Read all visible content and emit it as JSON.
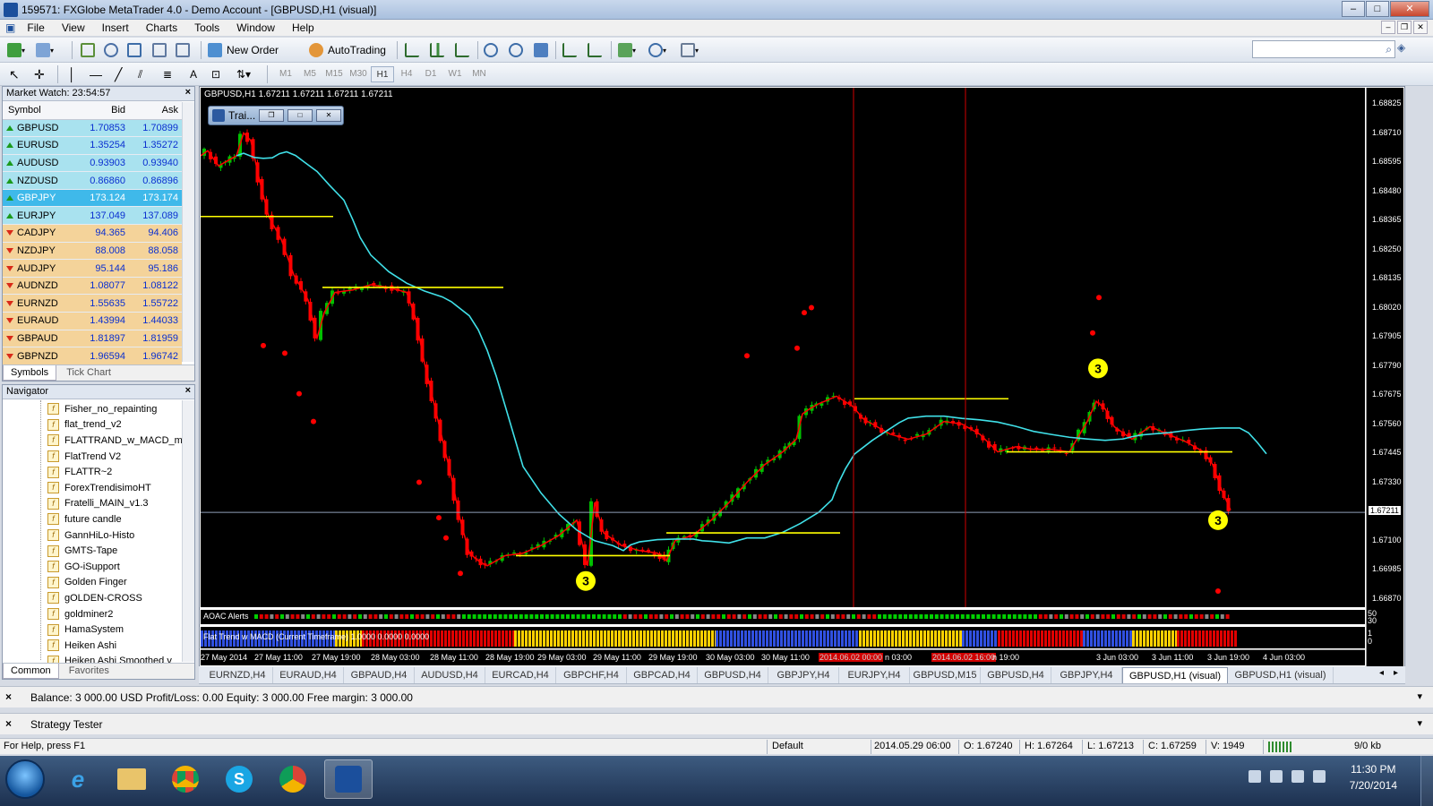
{
  "window": {
    "title": "159571: FXGlobe MetaTrader 4.0 - Demo Account - [GBPUSD,H1 (visual)]",
    "controls": [
      "–",
      "□",
      "✕"
    ]
  },
  "menu": [
    "File",
    "View",
    "Insert",
    "Charts",
    "Tools",
    "Window",
    "Help"
  ],
  "toolbar": {
    "new_order": "New Order",
    "autotrading": "AutoTrading",
    "timeframes": [
      "M1",
      "M5",
      "M15",
      "M30",
      "H1",
      "H4",
      "D1",
      "W1",
      "MN"
    ],
    "active_timeframe": "H1",
    "drawing_label": "A"
  },
  "market_watch": {
    "title": "Market Watch: 23:54:57",
    "columns": [
      "Symbol",
      "Bid",
      "Ask"
    ],
    "rows": [
      {
        "symbol": "GBPUSD",
        "bid": "1.70853",
        "ask": "1.70899",
        "dir": "up"
      },
      {
        "symbol": "EURUSD",
        "bid": "1.35254",
        "ask": "1.35272",
        "dir": "up"
      },
      {
        "symbol": "AUDUSD",
        "bid": "0.93903",
        "ask": "0.93940",
        "dir": "up"
      },
      {
        "symbol": "NZDUSD",
        "bid": "0.86860",
        "ask": "0.86896",
        "dir": "up"
      },
      {
        "symbol": "GBPJPY",
        "bid": "173.124",
        "ask": "173.174",
        "dir": "sel"
      },
      {
        "symbol": "EURJPY",
        "bid": "137.049",
        "ask": "137.089",
        "dir": "up"
      },
      {
        "symbol": "CADJPY",
        "bid": "94.365",
        "ask": "94.406",
        "dir": "down"
      },
      {
        "symbol": "NZDJPY",
        "bid": "88.008",
        "ask": "88.058",
        "dir": "down"
      },
      {
        "symbol": "AUDJPY",
        "bid": "95.144",
        "ask": "95.186",
        "dir": "down"
      },
      {
        "symbol": "AUDNZD",
        "bid": "1.08077",
        "ask": "1.08122",
        "dir": "down"
      },
      {
        "symbol": "EURNZD",
        "bid": "1.55635",
        "ask": "1.55722",
        "dir": "down"
      },
      {
        "symbol": "EURAUD",
        "bid": "1.43994",
        "ask": "1.44033",
        "dir": "down"
      },
      {
        "symbol": "GBPAUD",
        "bid": "1.81897",
        "ask": "1.81959",
        "dir": "down"
      },
      {
        "symbol": "GBPNZD",
        "bid": "1.96594",
        "ask": "1.96742",
        "dir": "down"
      }
    ],
    "tabs": [
      "Symbols",
      "Tick Chart"
    ]
  },
  "navigator": {
    "title": "Navigator",
    "items": [
      "Fisher_no_repainting",
      "flat_trend_v2",
      "FLATTRAND_w_MACD_mtf",
      "FlatTrend V2",
      "FLATTR~2",
      "ForexTrendisimoHT",
      "Fratelli_MAIN_v1.3",
      "future candle",
      "GannHiLo-Histo",
      "GMTS-Tape",
      "GO-iSupport",
      "Golden Finger",
      "gOLDEN-CROSS",
      "goldminer2",
      "HamaSystem",
      "Heiken Ashi",
      "Heiken Ashi Smoothed v"
    ],
    "tabs": [
      "Common",
      "Favorites"
    ]
  },
  "chart": {
    "header": "GBPUSD,H1  1.67211 1.67211 1.67211 1.67211",
    "float_window_title": "Trai...",
    "price_labels": [
      "1.68825",
      "1.68710",
      "1.68595",
      "1.68480",
      "1.68365",
      "1.68250",
      "1.68135",
      "1.68020",
      "1.67905",
      "1.67790",
      "1.67675",
      "1.67560",
      "1.67445",
      "1.67330",
      "1.67211",
      "1.67100",
      "1.66985",
      "1.66870"
    ],
    "current_price": "1.67211",
    "time_labels": [
      "27 May 2014",
      "27 May 11:00",
      "27 May 19:00",
      "28 May 03:00",
      "28 May 11:00",
      "28 May 19:00",
      "29 May 03:00",
      "29 May 11:00",
      "29 May 19:00",
      "30 May 03:00",
      "30 May 11:00",
      "2014.06.02 00:00",
      "n 03:00",
      "2014.06.02 16:00",
      "n 19:00",
      "3 Jun 03:00",
      "3 Jun 11:00",
      "3 Jun 19:00",
      "4 Jun 03:00"
    ],
    "signal_marker": "3",
    "sub1_label": "AOAC Alerts",
    "sub1_scale": [
      "50",
      "30"
    ],
    "sub2_label": "Flat Trend w MACD (Current Timeframe) 1.0000 0.0000 0.0000",
    "sub2_scale": [
      "1",
      "0"
    ]
  },
  "chart_tabs": [
    "EURNZD,H4",
    "EURAUD,H4",
    "GBPAUD,H4",
    "AUDUSD,H4",
    "EURCAD,H4",
    "GBPCHF,H4",
    "GBPCAD,H4",
    "GBPUSD,H4",
    "GBPJPY,H4",
    "EURJPY,H4",
    "GBPUSD,M15",
    "GBPUSD,H4",
    "GBPJPY,H4",
    "GBPUSD,H1 (visual)",
    "GBPUSD,H1 (visual)"
  ],
  "active_chart_tab": 13,
  "terminal": {
    "balance_line": "Balance: 3 000.00 USD  Profit/Loss: 0.00  Equity: 3 000.00  Free margin: 3 000.00",
    "strategy_tester": "Strategy Tester"
  },
  "status": {
    "help": "For Help, press F1",
    "profile": "Default",
    "datetime": "2014.05.29 06:00",
    "open": "O: 1.67240",
    "high": "H: 1.67264",
    "low": "L: 1.67213",
    "close": "C: 1.67259",
    "volume": "V: 1949",
    "traffic": "9/0 kb"
  },
  "taskbar": {
    "time": "11:30 PM",
    "date": "7/20/2014"
  },
  "colors": {
    "chart_bg": "#000000",
    "bull_candle": "#00c000",
    "bear_candle": "#ff0000",
    "ma_fast": "#ff0000",
    "ma_slow": "#40e0e8",
    "level_line": "#ffff00",
    "signal_dot": "#ff0000"
  }
}
